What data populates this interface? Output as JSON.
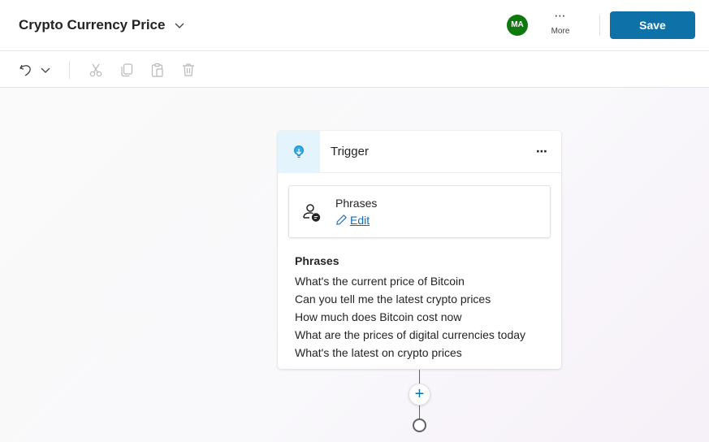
{
  "header": {
    "title": "Crypto Currency Price",
    "avatar_initials": "MA",
    "more_label": "More",
    "more_glyph": "⋯",
    "save_label": "Save"
  },
  "toolbar": {
    "icons": [
      "undo-icon",
      "chevron-down-icon",
      "cut-icon",
      "copy-icon",
      "paste-icon",
      "delete-icon"
    ]
  },
  "node": {
    "trigger_label": "Trigger",
    "more_glyph": "⋯",
    "phrases_box": {
      "title": "Phrases",
      "edit_label": "Edit"
    },
    "list_title": "Phrases",
    "phrases": [
      "What's the current price of Bitcoin",
      "Can you tell me the latest crypto prices",
      "How much does Bitcoin cost now",
      "What are the prices of digital currencies today",
      "What's the latest on crypto prices"
    ]
  },
  "add_node_glyph": "+",
  "colors": {
    "accent": "#0e72a8",
    "avatar": "#0e7a0d",
    "trigger_bg": "#e4f4fc",
    "link": "#0f6cbd"
  }
}
